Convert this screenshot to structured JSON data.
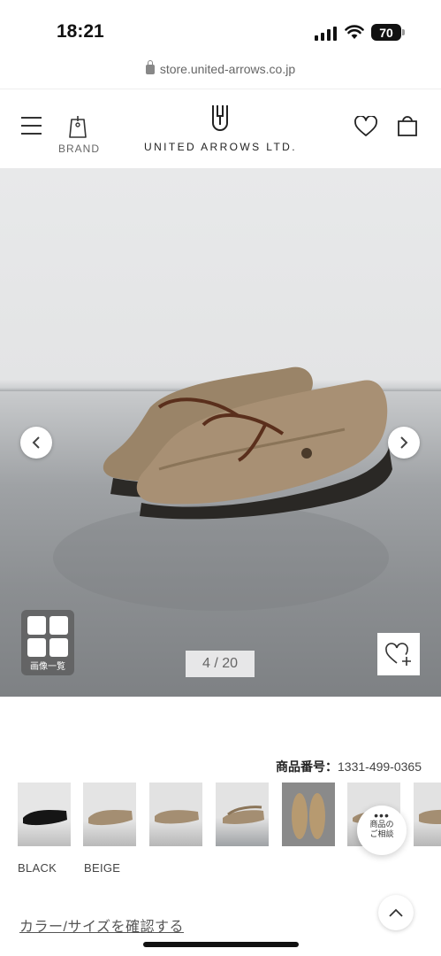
{
  "status_bar": {
    "time": "18:21",
    "battery": "70"
  },
  "browser": {
    "url": "store.united-arrows.co.jp"
  },
  "header": {
    "brand_label": "BRAND",
    "logo_text": "UNITED ARROWS LTD."
  },
  "hero": {
    "counter": "4 / 20",
    "gallery_label": "画像一覧",
    "current_image": 4,
    "total_images": 20
  },
  "product": {
    "number_label": "商品番号：",
    "number_value": "1331-499-0365"
  },
  "thumbnails": [
    {
      "name": "black-moccasin"
    },
    {
      "name": "beige-moccasin"
    },
    {
      "name": "beige-moccasin-angle"
    },
    {
      "name": "beige-pair-active"
    },
    {
      "name": "beige-top-view"
    },
    {
      "name": "beige-side"
    },
    {
      "name": "beige-partial"
    }
  ],
  "colors": [
    "BLACK",
    "BEIGE"
  ],
  "consult": {
    "line1": "商品の",
    "line2": "ご相談"
  },
  "links": {
    "confirm": "カラー/サイズを確認する"
  },
  "theme": {
    "accent": "#222222",
    "hero_floor": "#8b8e91",
    "shoe": "#a48e72"
  }
}
